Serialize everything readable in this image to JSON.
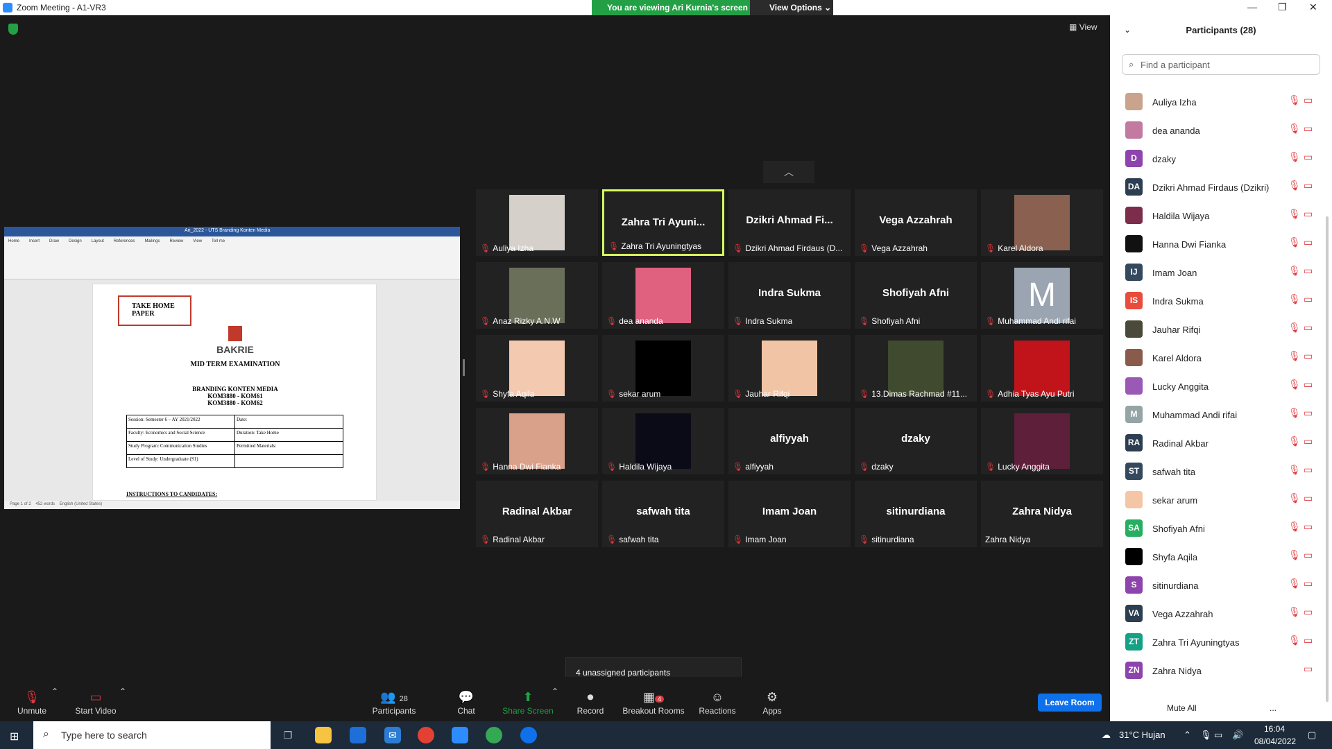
{
  "window": {
    "title": "Zoom Meeting - A1-VR3",
    "viewing_banner": "You are viewing Ari Kurnia's screen",
    "view_options": "View Options",
    "view_label": "View"
  },
  "document": {
    "doc_title": "Ari_2022 - UTS Branding Konten Media",
    "tabs": [
      "Home",
      "Insert",
      "Draw",
      "Design",
      "Layout",
      "References",
      "Mailings",
      "Review",
      "View",
      "Tell me"
    ],
    "box_title_line1": "TAKE HOME",
    "box_title_line2": "PAPER",
    "university": "BAKRIE",
    "exam_title": "MID TERM EXAMINATION",
    "course_name": "BRANDING KONTEN MEDIA",
    "course_code1": "KOM3880 - KOM61",
    "course_code2": "KOM3880 - KOM62",
    "session": "Session: Semester 6 – AY 2021/2022",
    "date": "Date:",
    "faculty": "Faculty: Economics and Social Science",
    "duration": "Duration: Take Home",
    "program": "Study Program: Communication Studies",
    "materials": "Permitted Materials:",
    "level": "Level of Study: Undergraduate (S1)",
    "instructions": "INSTRUCTIONS TO CANDIDATES:",
    "status_page": "Page 1 of 2",
    "status_words": "452 words",
    "status_lang": "English (United States)"
  },
  "tiles": [
    {
      "big": "",
      "label": "Auliya Izha",
      "avatar": "photo"
    },
    {
      "big": "Zahra Tri Ayuni...",
      "label": "Zahra Tri Ayuningtyas",
      "avatar": "none"
    },
    {
      "big": "Dzikri Ahmad Fi...",
      "label": "Dzikri Ahmad Firdaus (D...",
      "avatar": "none"
    },
    {
      "big": "Vega Azzahrah",
      "label": "Vega Azzahrah",
      "avatar": "none"
    },
    {
      "big": "",
      "label": "Karel Aldora",
      "avatar": "photo"
    },
    {
      "big": "",
      "label": "Anaz Rizky A.N.W",
      "avatar": "photo"
    },
    {
      "big": "",
      "label": "dea ananda",
      "avatar": "photo"
    },
    {
      "big": "Indra Sukma",
      "label": "Indra Sukma",
      "avatar": "none"
    },
    {
      "big": "Shofiyah Afni",
      "label": "Shofiyah Afni",
      "avatar": "none"
    },
    {
      "big": "",
      "label": "Muhammad Andi rifai",
      "avatar": "M"
    },
    {
      "big": "",
      "label": "Shyfa Aqila",
      "avatar": "photo"
    },
    {
      "big": "",
      "label": "sekar arum",
      "avatar": "photo"
    },
    {
      "big": "",
      "label": "Jauhar Rifqi",
      "avatar": "photo"
    },
    {
      "big": "",
      "label": "13.Dimas Rachmad #11...",
      "avatar": "photo"
    },
    {
      "big": "",
      "label": "Adhia Tyas Ayu Putri",
      "avatar": "photo"
    },
    {
      "big": "",
      "label": "Hanna Dwi Fianka",
      "avatar": "photo"
    },
    {
      "big": "",
      "label": "Haldila Wijaya",
      "avatar": "photo"
    },
    {
      "big": "alfiyyah",
      "label": "alfiyyah",
      "avatar": "none"
    },
    {
      "big": "dzaky",
      "label": "dzaky",
      "avatar": "none"
    },
    {
      "big": "",
      "label": "Lucky Anggita",
      "avatar": "photo"
    },
    {
      "big": "Radinal Akbar",
      "label": "Radinal Akbar",
      "avatar": "none"
    },
    {
      "big": "safwah tita",
      "label": "safwah tita",
      "avatar": "none"
    },
    {
      "big": "Imam Joan",
      "label": "Imam Joan",
      "avatar": "none"
    },
    {
      "big": "sitinurdiana",
      "label": "sitinurdiana",
      "avatar": "none"
    },
    {
      "big": "Zahra Nidya",
      "label": "Zahra Nidya",
      "avatar": "none"
    }
  ],
  "unassigned": "4 unassigned participants",
  "toolbar": {
    "unmute": "Unmute",
    "start_video": "Start Video",
    "participants_count": "28",
    "participants": "Participants",
    "chat": "Chat",
    "share_screen": "Share Screen",
    "record": "Record",
    "breakout_badge": "4",
    "breakout": "Breakout Rooms",
    "reactions": "Reactions",
    "apps": "Apps",
    "leave": "Leave Room"
  },
  "panel": {
    "title": "Participants (28)",
    "search_placeholder": "Find a participant",
    "mute_all": "Mute All",
    "more": "...",
    "people": [
      {
        "name": "Auliya Izha",
        "initials": "",
        "color": "#c9a38c"
      },
      {
        "name": "dea ananda",
        "initials": "",
        "color": "#c27aa0"
      },
      {
        "name": "dzaky",
        "initials": "D",
        "color": "#8e44ad"
      },
      {
        "name": "Dzikri Ahmad Firdaus (Dzikri)",
        "initials": "DA",
        "color": "#2c3e50"
      },
      {
        "name": "Haldila Wijaya",
        "initials": "",
        "color": "#7b2d4a"
      },
      {
        "name": "Hanna Dwi Fianka",
        "initials": "",
        "color": "#111111"
      },
      {
        "name": "Imam Joan",
        "initials": "IJ",
        "color": "#34495e"
      },
      {
        "name": "Indra Sukma",
        "initials": "IS",
        "color": "#e74c3c"
      },
      {
        "name": "Jauhar Rifqi",
        "initials": "",
        "color": "#4a4a3a"
      },
      {
        "name": "Karel Aldora",
        "initials": "",
        "color": "#8a5a4a"
      },
      {
        "name": "Lucky Anggita",
        "initials": "",
        "color": "#9b59b6"
      },
      {
        "name": "Muhammad Andi rifai",
        "initials": "M",
        "color": "#95a5a6"
      },
      {
        "name": "Radinal Akbar",
        "initials": "RA",
        "color": "#2c3e50"
      },
      {
        "name": "safwah tita",
        "initials": "ST",
        "color": "#34495e"
      },
      {
        "name": "sekar arum",
        "initials": "",
        "color": "#f5c6a5"
      },
      {
        "name": "Shofiyah Afni",
        "initials": "SA",
        "color": "#27ae60"
      },
      {
        "name": "Shyfa Aqila",
        "initials": "",
        "color": "#000000"
      },
      {
        "name": "sitinurdiana",
        "initials": "S",
        "color": "#8e44ad"
      },
      {
        "name": "Vega Azzahrah",
        "initials": "VA",
        "color": "#2c3e50"
      },
      {
        "name": "Zahra Tri Ayuningtyas",
        "initials": "ZT",
        "color": "#16a085"
      },
      {
        "name": "Zahra Nidya",
        "initials": "ZN",
        "color": "#8e44ad"
      }
    ]
  },
  "taskbar": {
    "search_placeholder": "Type here to search",
    "weather": "31°C  Hujan",
    "time": "16:04",
    "date": "08/04/2022"
  }
}
